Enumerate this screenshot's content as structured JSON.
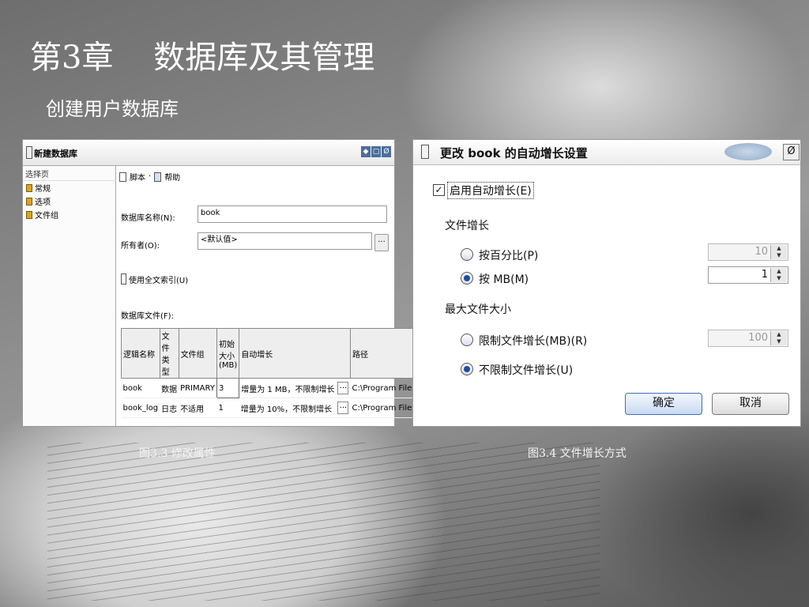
{
  "slide": {
    "title": "第3章    数据库及其管理",
    "subtitle": "创建用户数据库",
    "caption_left": "图3.3   修改属性",
    "caption_right": "图3.4   文件增长方式"
  },
  "left_window": {
    "title": "新建数据库",
    "controls": [
      "◆",
      "▢",
      "Ø"
    ],
    "select_page_label": "选择页",
    "pages": [
      "常规",
      "选项",
      "文件组"
    ],
    "toolbar": {
      "script": "脚本",
      "sep": "·",
      "help": "帮助"
    },
    "db_name_label": "数据库名称(N):",
    "db_name_value": "book",
    "owner_label": "所有者(O):",
    "owner_value": "<默认值>",
    "fulltext_label": "使用全文索引(U)",
    "files_label": "数据库文件(F):",
    "columns": [
      "逻辑名称",
      "文件类型",
      "文件组",
      "初始大小(MB)",
      "自动增长",
      "路径"
    ],
    "rows": [
      [
        "book",
        "数据",
        "PRIMARY",
        "3",
        "增量为 1 MB，不限制增长",
        "...",
        "C:\\Program Files\\Micro"
      ],
      [
        "book_log",
        "日志",
        "不适用",
        "1",
        "增量为 10%，不限制增长",
        "...",
        "C:\\Program Files\\Micro"
      ]
    ]
  },
  "right_window": {
    "title": "更改 book 的自动增长设置",
    "close": "Ø",
    "enable_label": "启用自动增长(E)",
    "enable_checked": "✓",
    "growth_heading": "文件增长",
    "opt_percent": "按百分比(P)",
    "percent_value": "10",
    "opt_mb": "按 MB(M)",
    "mb_value": "1",
    "max_heading": "最大文件大小",
    "opt_limit": "限制文件增长(MB)(R)",
    "limit_value": "100",
    "opt_unlimited": "不限制文件增长(U)",
    "ok": "确定",
    "cancel": "取消",
    "spin_up": "▲",
    "spin_down": "▼"
  }
}
